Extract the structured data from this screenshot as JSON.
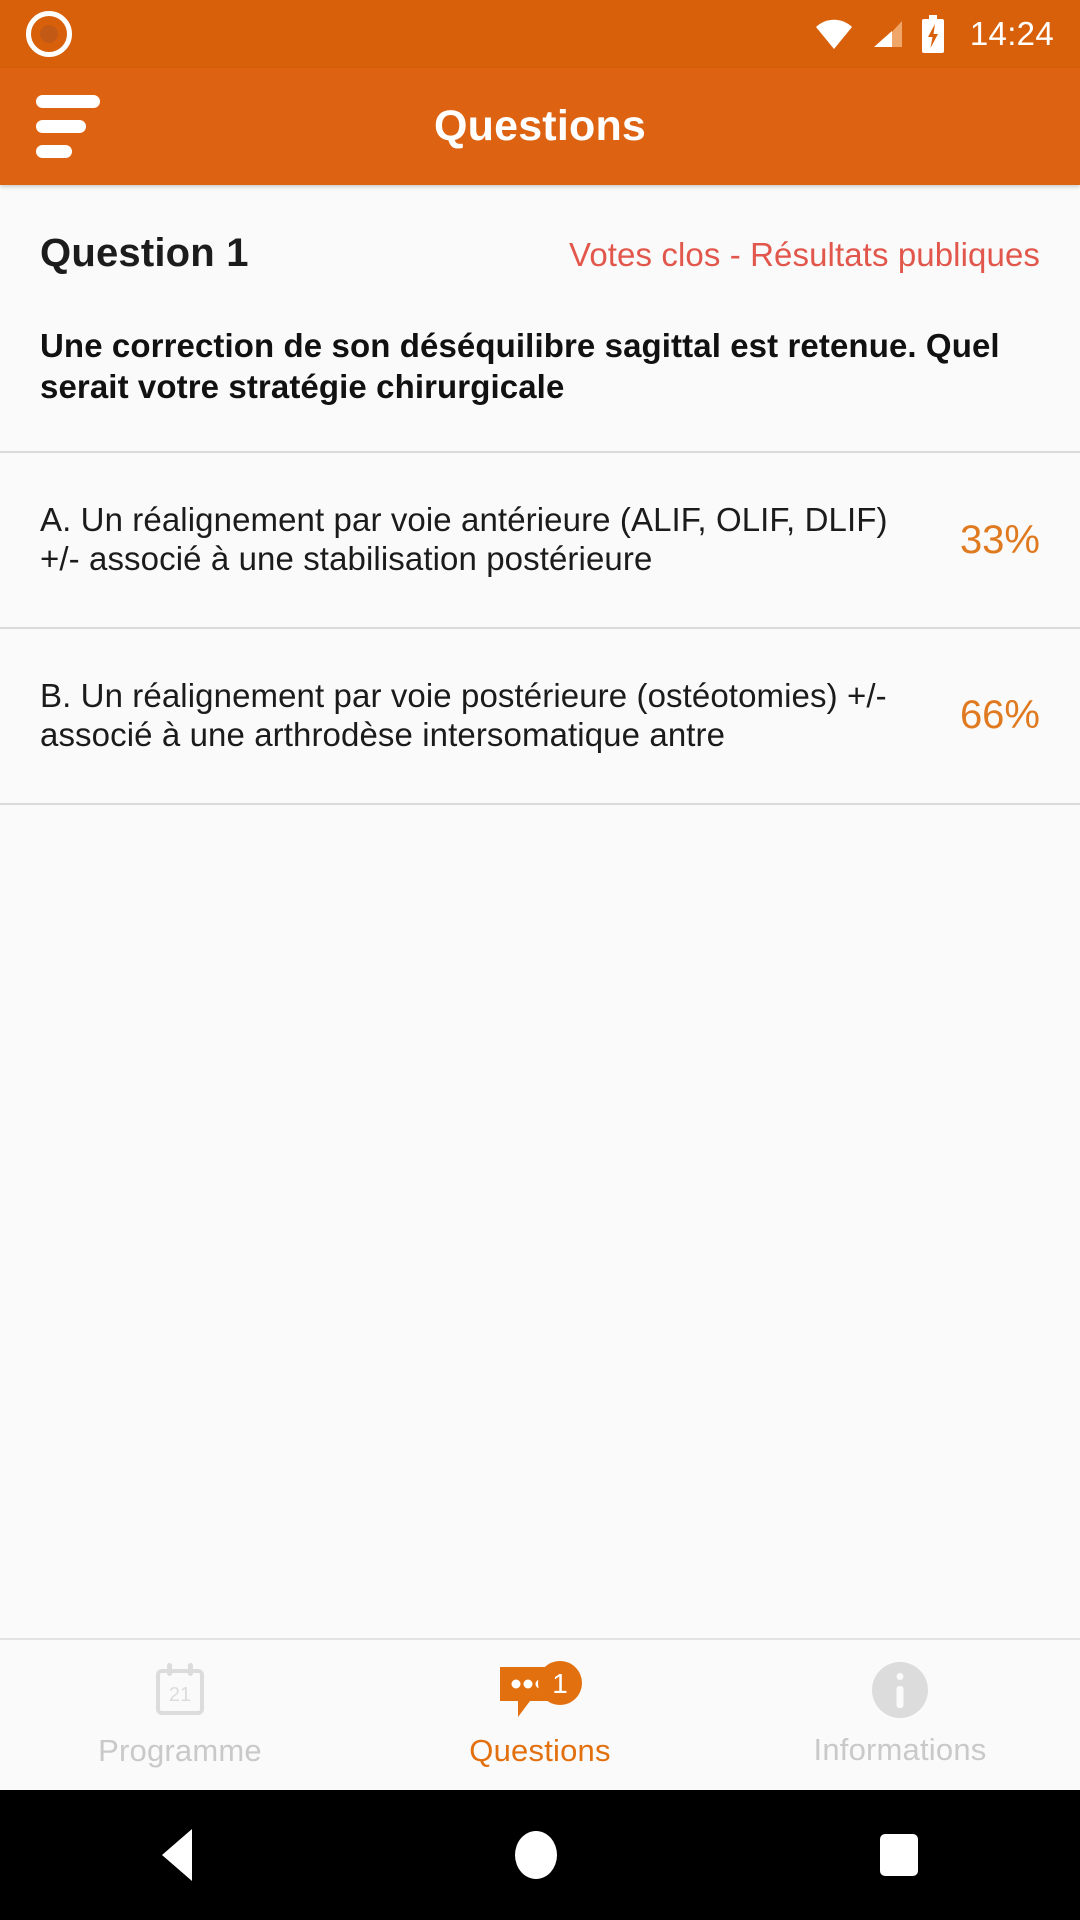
{
  "statusbar": {
    "time": "14:24",
    "icons": [
      "record-dot-icon",
      "wifi-icon",
      "cellular-signal-icon",
      "battery-charging-icon"
    ]
  },
  "appbar": {
    "menu_icon": "hamburger-menu-icon",
    "title": "Questions"
  },
  "question": {
    "number_label": "Question 1",
    "status_label": "Votes clos - Résultats publiques",
    "text": "Une correction de son déséquilibre sagittal est retenue. Quel serait votre stratégie chirurgicale",
    "options": [
      {
        "text": "A. Un réalignement par voie antérieure (ALIF, OLIF, DLIF) +/- associé à une stabilisation postérieure",
        "percent": "33%"
      },
      {
        "text": "B. Un réalignement par voie postérieure (ostéotomies) +/- associé à une arthrodèse intersomatique antre",
        "percent": "66%"
      }
    ]
  },
  "tabbar": {
    "tabs": [
      {
        "label": "Programme",
        "icon": "calendar-icon",
        "calendar_day": "21",
        "active": false
      },
      {
        "label": "Questions",
        "icon": "chat-bubble-icon",
        "badge": "1",
        "active": true
      },
      {
        "label": "Informations",
        "icon": "info-circle-icon",
        "active": false
      }
    ]
  },
  "navbar": {
    "back": "back-triangle-icon",
    "home": "home-circle-icon",
    "recents": "recents-square-icon"
  },
  "colors": {
    "appbar_orange": "#dd6211",
    "statusbar_orange": "#d9600a",
    "accent_orange": "#e07a20",
    "status_red": "#e2574c",
    "inactive_gray": "#c9c9c9",
    "page_bg": "#fafafa"
  }
}
